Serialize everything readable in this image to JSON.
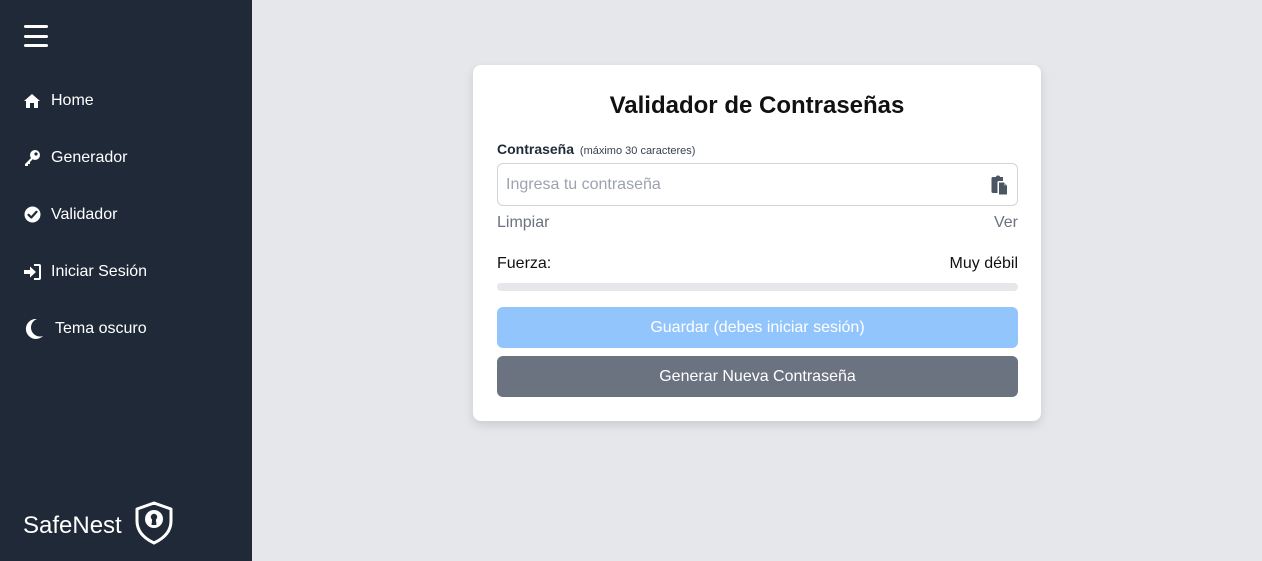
{
  "sidebar": {
    "items": [
      {
        "label": "Home",
        "icon": "home-icon"
      },
      {
        "label": "Generador",
        "icon": "key-icon"
      },
      {
        "label": "Validador",
        "icon": "check-circle-icon"
      },
      {
        "label": "Iniciar Sesión",
        "icon": "sign-in-icon"
      },
      {
        "label": "Tema oscuro",
        "icon": "moon-icon"
      }
    ],
    "brand": "SafeNest"
  },
  "validator": {
    "title": "Validador de Contraseñas",
    "field_label": "Contraseña",
    "field_hint": "(máximo 30 caracteres)",
    "placeholder": "Ingresa tu contraseña",
    "value": "",
    "clear_label": "Limpiar",
    "show_label": "Ver",
    "strength_label": "Fuerza:",
    "strength_value": "Muy débil",
    "strength_fraction": 0,
    "save_label": "Guardar (debes iniciar sesión)",
    "generate_label": "Generar Nueva Contraseña"
  },
  "colors": {
    "sidebar_bg": "#1f2937",
    "page_bg": "#e5e7eb",
    "save_button": "#93c5fd",
    "generate_button": "#6b7280"
  }
}
